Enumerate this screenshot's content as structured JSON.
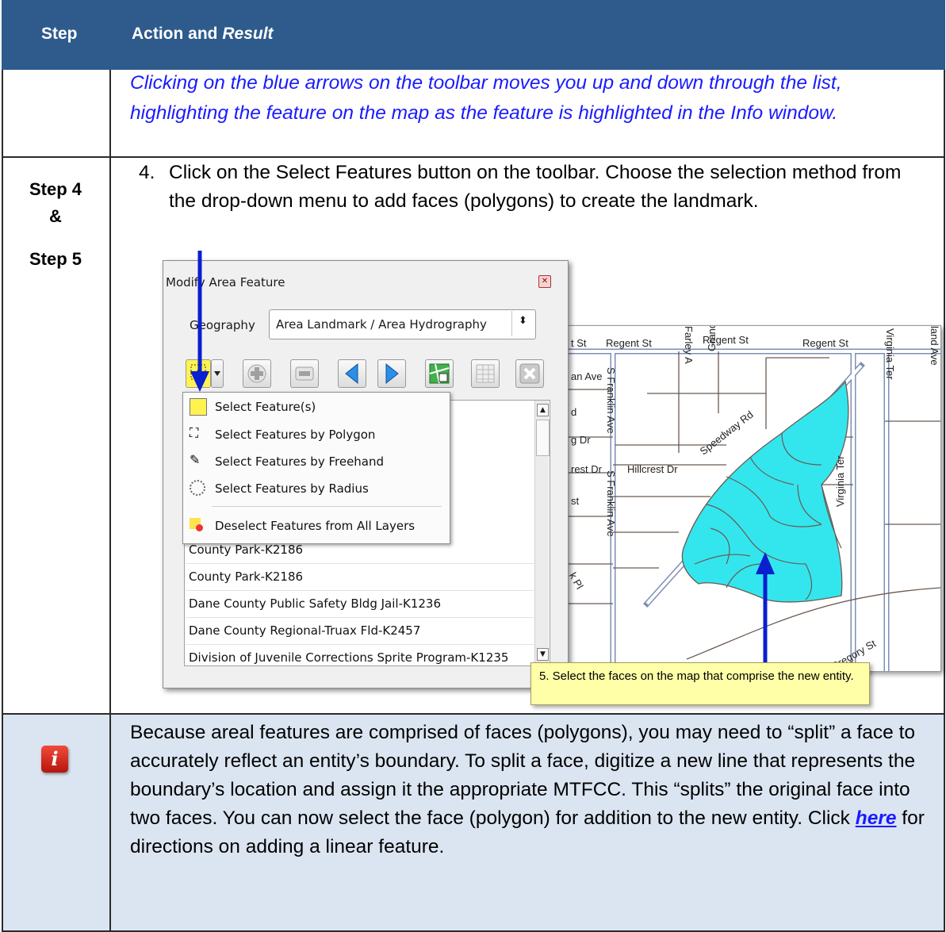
{
  "table": {
    "header_step": "Step",
    "header_action": "Action and ",
    "header_result": "Result"
  },
  "row1": {
    "result_text": "Clicking on the blue arrows on the toolbar moves you up and down through the list, highlighting the feature on the map as the feature is highlighted in the Info window."
  },
  "row2": {
    "step_label_1": "Step 4",
    "step_label_amp": "&",
    "step_label_2": "Step 5",
    "instruction_number": "4.",
    "instruction_text": "Click on the Select Features button on the toolbar. Choose the selection method from the drop-down menu to add faces (polygons) to create the landmark."
  },
  "dialog": {
    "title": "Modify Area Feature",
    "geography_label": "Geography",
    "geography_value": "Area Landmark / Area Hydrography",
    "menu_items": [
      "Select Feature(s)",
      "Select Features by Polygon",
      "Select Features by Freehand",
      "Select Features by Radius",
      "Deselect Features from All Layers"
    ],
    "list_items": [
      "County Park-K2186",
      "County Park-K2186",
      "Dane County Public Safety Bldg Jail-K1236",
      "Dane County Regional-Truax Fld-K2457",
      "Division of Juvenile Corrections Sprite Program-K1235"
    ]
  },
  "map": {
    "labels": {
      "st1": "t St",
      "regent1": "Regent St",
      "regent2": "Regent St",
      "regent3": "Regent St",
      "farley": "Farley A",
      "grand": "Grand",
      "land_ave": "land Ave",
      "virginia_ter1": "Virginia Ter",
      "virginia_ter2": "Virginia Ter",
      "an_ave": "an Ave",
      "d": "d",
      "s_franklin1": "S Franklin Ave",
      "speedway": "Speedway Rd",
      "g_dr": "g Dr",
      "rest_dr": "rest Dr",
      "hillcrest": "Hillcrest Dr",
      "s_franklin2": "S Franklin Ave",
      "st2": "st",
      "gregory": "Gregory St",
      "pl": "k Pl"
    }
  },
  "callout": {
    "text": "5. Select the faces on the map that comprise the new entity."
  },
  "note": {
    "text_1": "Because areal features are comprised of faces (polygons), you may need to “split” a face to accurately reflect an entity’s boundary. To split a face, digitize a new line that represents the boundary’s location and assign it the appropriate MTFCC. This “splits” the original face into two faces. You can now select the face (polygon) for addition to the new entity. Click ",
    "link": "here",
    "text_2": " for directions on adding a linear feature."
  },
  "colors": {
    "header_bg": "#2e5b8c",
    "result_text": "#1a1aff",
    "note_bg": "#dbe5f1",
    "selected_faces": "#33e6ee",
    "arrow": "#0a1fcf"
  }
}
